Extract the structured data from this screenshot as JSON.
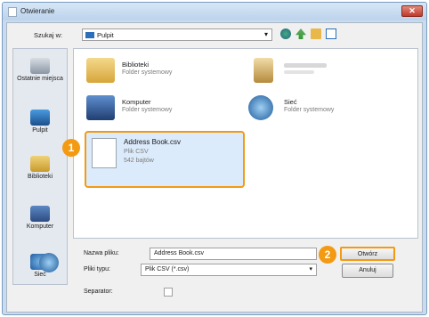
{
  "window": {
    "title": "Otwieranie",
    "close_label": "✕"
  },
  "toolbar": {
    "lookin_label": "Szukaj w:",
    "lookin_value": "Pulpit",
    "lookin_arrow": "▾"
  },
  "places": [
    {
      "label": "Ostatnie miejsca",
      "icon": "recent-places-icon"
    },
    {
      "label": "Pulpit",
      "icon": "desktop-icon"
    },
    {
      "label": "Biblioteki",
      "icon": "libraries-icon"
    },
    {
      "label": "Komputer",
      "icon": "computer-icon"
    },
    {
      "label": "Sieć",
      "icon": "network-icon"
    }
  ],
  "files": {
    "libraries": {
      "name": "Biblioteki",
      "sub": "Folder systemowy"
    },
    "computer": {
      "name": "Komputer",
      "sub": "Folder systemowy"
    },
    "network": {
      "name": "Sieć",
      "sub": "Folder systemowy"
    },
    "csv": {
      "name": "Address Book.csv",
      "type": "Plik CSV",
      "size": "542 bajtów"
    }
  },
  "badges": {
    "one": "1",
    "two": "2"
  },
  "bottom": {
    "filename_label": "Nazwa pliku:",
    "filename_value": "Address Book.csv",
    "filetype_label": "Pliki typu:",
    "filetype_value": "Plik CSV (*.csv)",
    "separator_label": "Separator:",
    "open_label": "Otwórz",
    "cancel_label": "Anuluj",
    "dropdown_arrow": "▾"
  },
  "colors": {
    "highlight": "#f39a12",
    "selection": "#dcebfb"
  }
}
